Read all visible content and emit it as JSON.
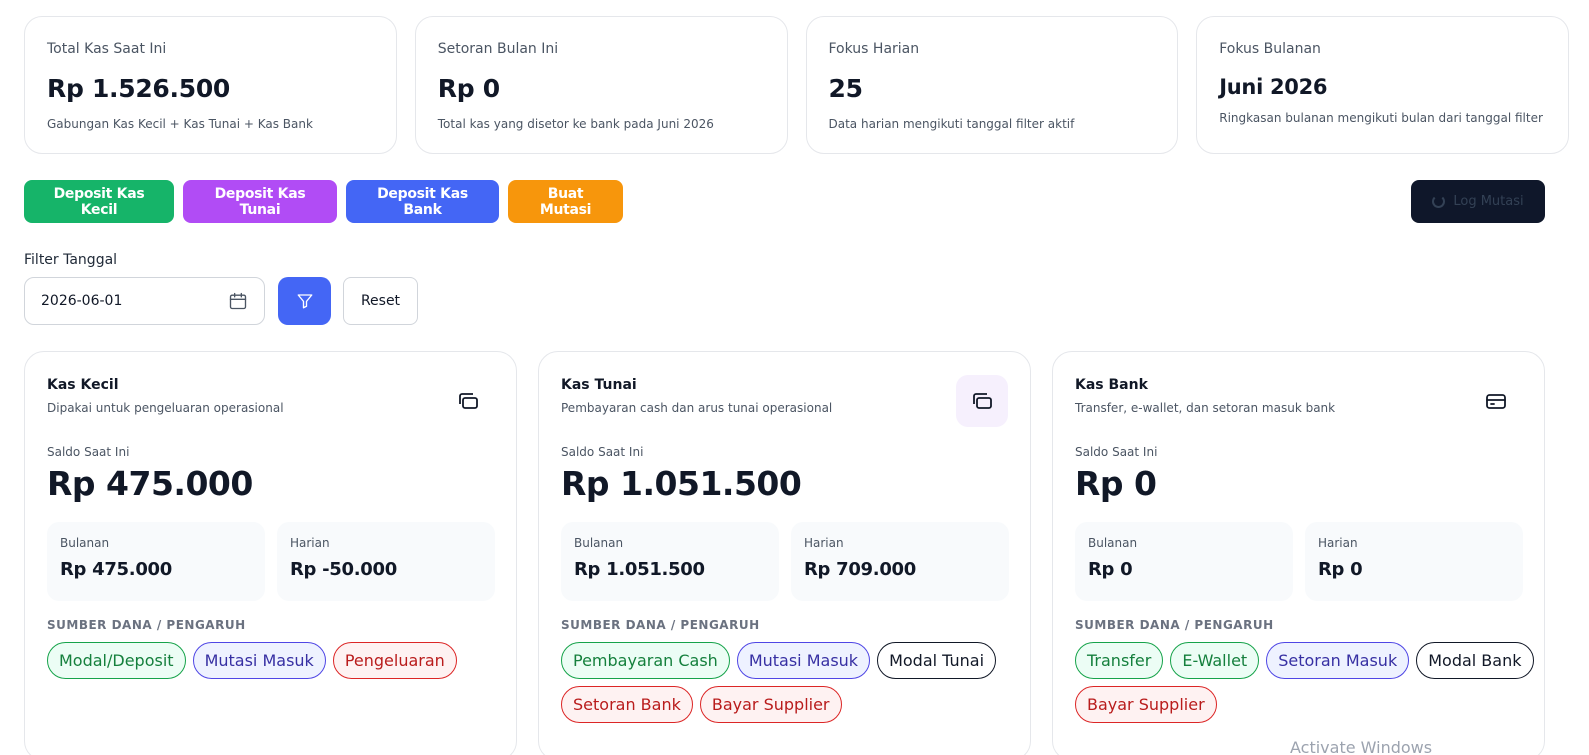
{
  "summary": [
    {
      "label": "Total Kas Saat Ini",
      "value": "Rp 1.526.500",
      "desc": "Gabungan Kas Kecil + Kas Tunai + Kas Bank"
    },
    {
      "label": "Setoran Bulan Ini",
      "value": "Rp 0",
      "desc": "Total kas yang disetor ke bank pada Juni 2026"
    },
    {
      "label": "Fokus Harian",
      "value": "25",
      "desc": "Data harian mengikuti tanggal filter aktif"
    },
    {
      "label": "Fokus Bulanan",
      "value": "Juni 2026",
      "desc": "Ringkasan bulanan mengikuti bulan dari tanggal filter"
    }
  ],
  "actions": {
    "deposit_kecil": "Deposit Kas Kecil",
    "deposit_tunai": "Deposit Kas Tunai",
    "deposit_bank": "Deposit Kas Bank",
    "buat_mutasi": "Buat Mutasi",
    "log_mutasi": "Log Mutasi"
  },
  "filter": {
    "label": "Filter Tanggal",
    "date_value": "2026-06-01",
    "reset_label": "Reset"
  },
  "accounts": [
    {
      "title": "Kas Kecil",
      "subtitle": "Dipakai untuk pengeluaran operasional",
      "icon": "wallet-stack-icon",
      "saldo_label": "Saldo Saat Ini",
      "saldo": "Rp 475.000",
      "monthly_label": "Bulanan",
      "monthly": "Rp 475.000",
      "daily_label": "Harian",
      "daily": "Rp -50.000",
      "source_label": "SUMBER DANA / PENGARUH",
      "chips": [
        {
          "label": "Modal/Deposit",
          "tone": "green"
        },
        {
          "label": "Mutasi Masuk",
          "tone": "blue"
        },
        {
          "label": "Pengeluaran",
          "tone": "red"
        }
      ]
    },
    {
      "title": "Kas Tunai",
      "subtitle": "Pembayaran cash dan arus tunai operasional",
      "icon": "wallet-stack-icon",
      "saldo_label": "Saldo Saat Ini",
      "saldo": "Rp 1.051.500",
      "monthly_label": "Bulanan",
      "monthly": "Rp 1.051.500",
      "daily_label": "Harian",
      "daily": "Rp 709.000",
      "source_label": "SUMBER DANA / PENGARUH",
      "chips": [
        {
          "label": "Pembayaran Cash",
          "tone": "green"
        },
        {
          "label": "Mutasi Masuk",
          "tone": "blue"
        },
        {
          "label": "Modal Tunai",
          "tone": "plain"
        },
        {
          "label": "Setoran Bank",
          "tone": "red"
        },
        {
          "label": "Bayar Supplier",
          "tone": "red"
        }
      ]
    },
    {
      "title": "Kas Bank",
      "subtitle": "Transfer, e-wallet, dan setoran masuk bank",
      "icon": "credit-card-icon",
      "saldo_label": "Saldo Saat Ini",
      "saldo": "Rp 0",
      "monthly_label": "Bulanan",
      "monthly": "Rp 0",
      "daily_label": "Harian",
      "daily": "Rp 0",
      "source_label": "SUMBER DANA / PENGARUH",
      "chips": [
        {
          "label": "Transfer",
          "tone": "green"
        },
        {
          "label": "E-Wallet",
          "tone": "green"
        },
        {
          "label": "Setoran Masuk",
          "tone": "blue"
        },
        {
          "label": "Modal Bank",
          "tone": "plain"
        },
        {
          "label": "Bayar Supplier",
          "tone": "red"
        }
      ]
    }
  ],
  "watermark": "Activate Windows"
}
